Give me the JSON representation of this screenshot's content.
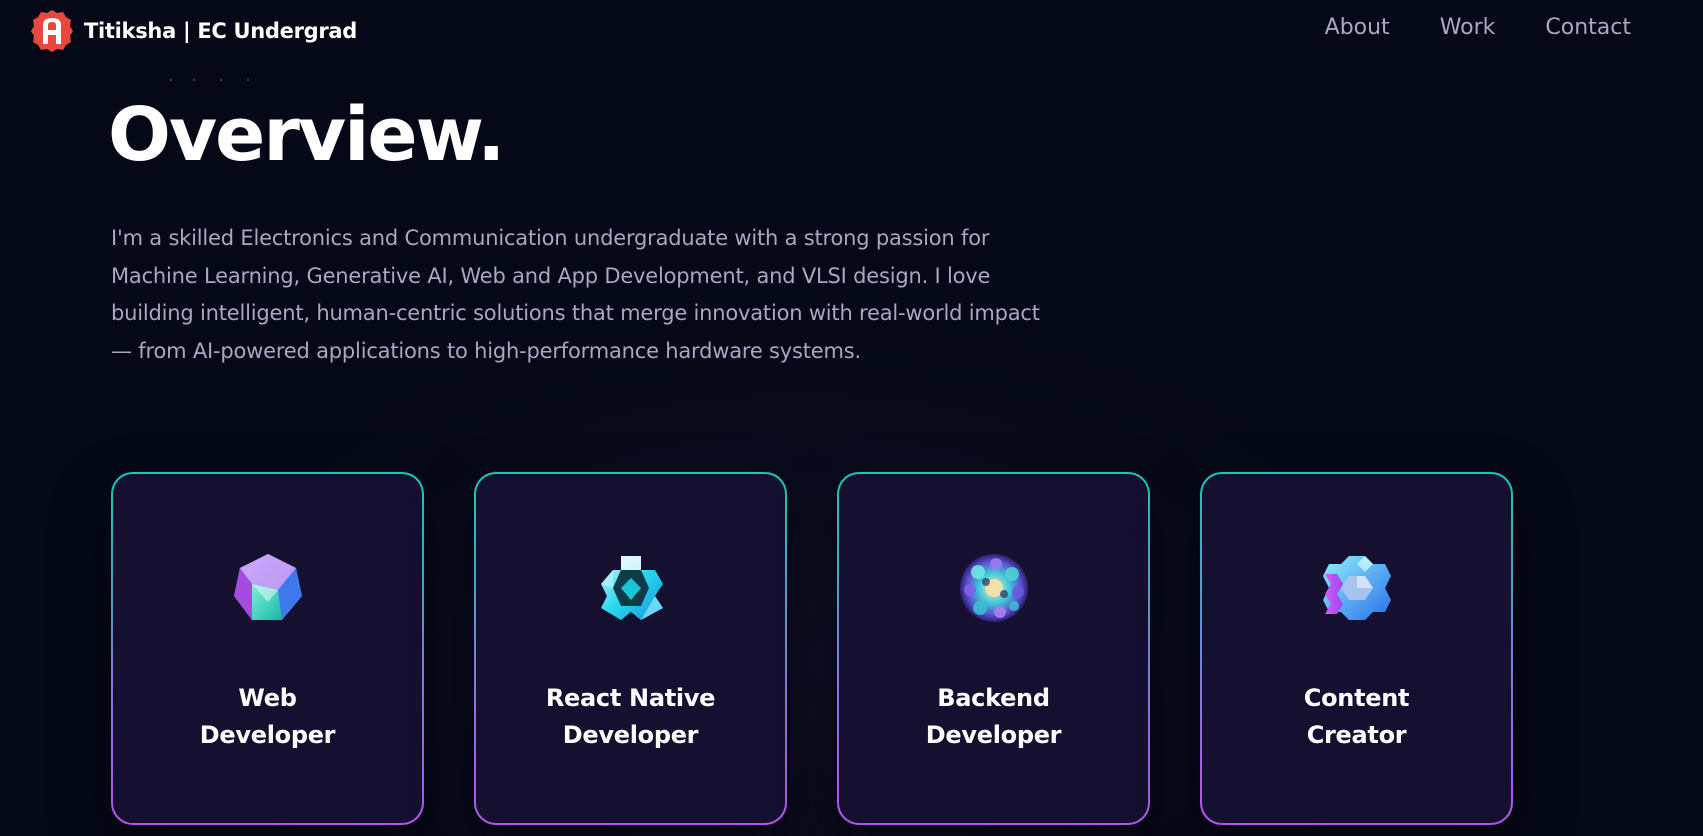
{
  "brand": {
    "name": "Titiksha",
    "tagline": " | EC Undergrad",
    "logo_icon": "letter-a-badge-icon",
    "logo_color": "#e8473d"
  },
  "nav": {
    "items": [
      {
        "label": "About"
      },
      {
        "label": "Work"
      },
      {
        "label": "Contact"
      }
    ]
  },
  "section": {
    "title": "Overview.",
    "text": "I'm a skilled Electronics and Communication undergraduate with a strong passion for Machine Learning, Generative AI, Web and App Development, and VLSI design. I love building intelligent, human-centric solutions that merge innovation with real-world impact — from AI-powered applications to high-performance hardware systems."
  },
  "services": [
    {
      "title": "Web\nDeveloper",
      "icon": "web-developer-icon"
    },
    {
      "title": "React Native\nDeveloper",
      "icon": "react-native-developer-icon"
    },
    {
      "title": "Backend\nDeveloper",
      "icon": "backend-developer-icon"
    },
    {
      "title": "Content\nCreator",
      "icon": "content-creator-icon"
    }
  ],
  "colors": {
    "background": "#050816",
    "card_background": "#151030",
    "secondary_text": "#aaa6c3",
    "card_border_top": "#18c9b0",
    "card_border_bottom": "#b553e8"
  }
}
